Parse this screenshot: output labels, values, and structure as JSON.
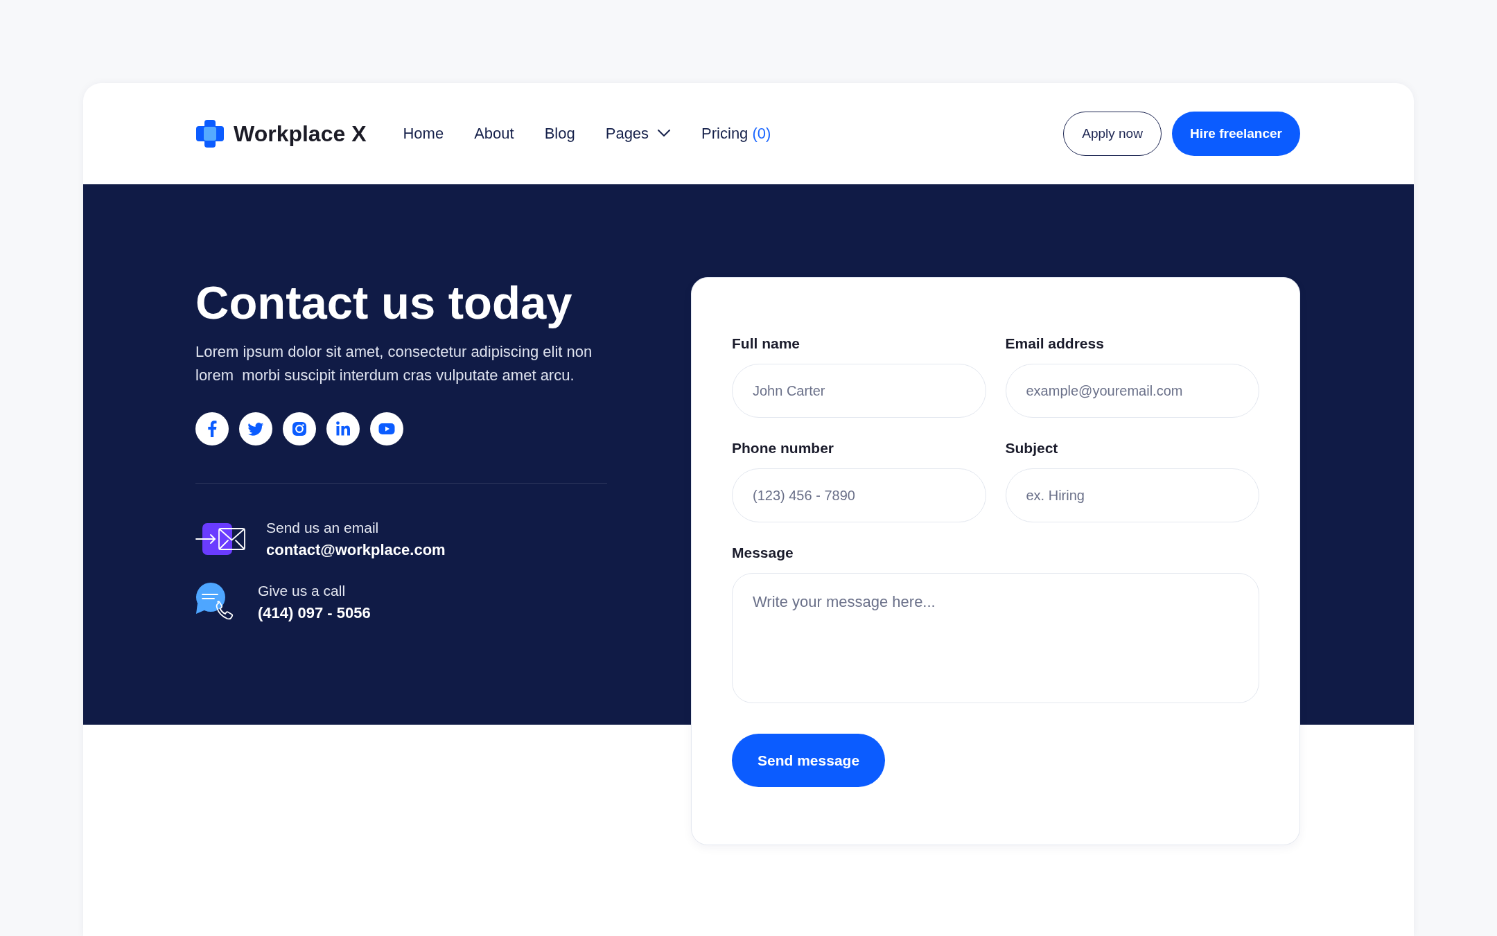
{
  "header": {
    "logo": "Workplace X",
    "nav": [
      {
        "label": "Home",
        "dropdown": false
      },
      {
        "label": "About",
        "dropdown": false
      },
      {
        "label": "Blog",
        "dropdown": false
      },
      {
        "label": "Pages",
        "dropdown": true
      },
      {
        "label": "Pricing",
        "count": "(0)",
        "dropdown": false
      }
    ],
    "buttons": [
      {
        "label": "Apply now",
        "kind": "outline"
      },
      {
        "label": "Hire freelancer",
        "kind": "primary"
      }
    ]
  },
  "hero": {
    "title": "Contact us today",
    "description": "Lorem ipsum dolor sit amet, consectetur adipiscing elit non lorem  morbi suscipit interdum cras vulputate amet arcu.",
    "contacts": [
      {
        "kind": "email",
        "label": "Send us an email",
        "value": "contact@workplace.com"
      },
      {
        "kind": "phone",
        "label": "Give us a call",
        "value": "(414) 097 - 5056"
      }
    ]
  },
  "form": {
    "fields": [
      {
        "kind": "text",
        "label": "Full name",
        "placeholder": "John Carter"
      },
      {
        "kind": "text",
        "label": "Email address",
        "placeholder": "example@youremail.com"
      },
      {
        "kind": "text",
        "label": "Phone number",
        "placeholder": "(123) 456 - 7890"
      },
      {
        "kind": "text",
        "label": "Subject",
        "placeholder": "ex. Hiring"
      },
      {
        "kind": "textarea",
        "label": "Message",
        "placeholder": "Write your message here..."
      }
    ],
    "submit": "Send message"
  }
}
